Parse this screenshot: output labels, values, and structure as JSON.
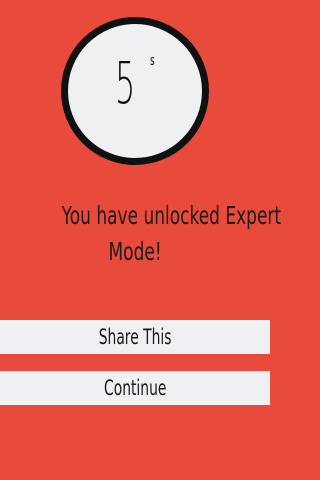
{
  "timer": {
    "value": "5",
    "unit": "s"
  },
  "message": {
    "line1": "You have unlocked Expert",
    "line2": "Mode!"
  },
  "buttons": {
    "share_label": "Share This",
    "continue_label": "Continue"
  },
  "colors": {
    "background": "#e84a3c",
    "panel": "#eef0f1",
    "text": "#1a1a1a",
    "ring": "#111111"
  }
}
